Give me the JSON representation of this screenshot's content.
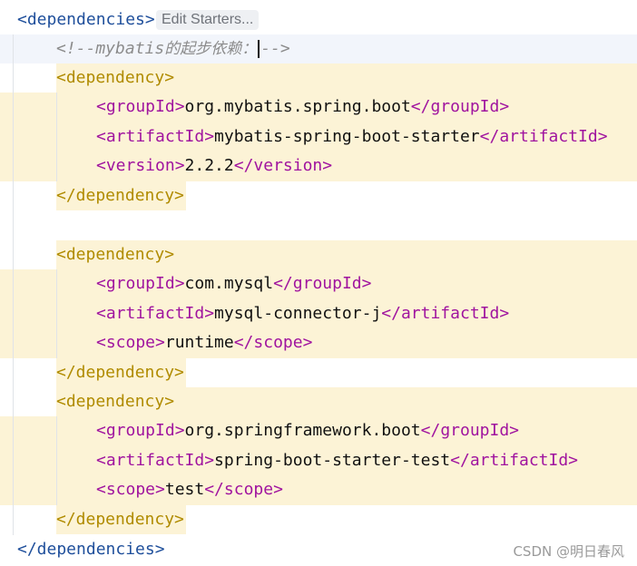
{
  "editor": {
    "inlay_hint": "Edit Starters...",
    "lines": {
      "deps_open": "<dependencies>",
      "comment_prefix": "<!--mybatis",
      "comment_cjk": "的起步依赖：",
      "comment_suffix": "-->",
      "dep1_open": "<dependency>",
      "dep1_group_open": "<groupId>",
      "dep1_group_value": "org.mybatis.spring.boot",
      "dep1_group_close": "</groupId>",
      "dep1_artifact_open": "<artifactId>",
      "dep1_artifact_value": "mybatis-spring-boot-starter",
      "dep1_artifact_close": "</artifactId>",
      "dep1_version_open": "<version>",
      "dep1_version_value": "2.2.2",
      "dep1_version_close": "</version>",
      "dep1_close": "</dependency>",
      "dep2_open": "<dependency>",
      "dep2_group_open": "<groupId>",
      "dep2_group_value": "com.mysql",
      "dep2_group_close": "</groupId>",
      "dep2_artifact_open": "<artifactId>",
      "dep2_artifact_value": "mysql-connector-j",
      "dep2_artifact_close": "</artifactId>",
      "dep2_scope_open": "<scope>",
      "dep2_scope_value": "runtime",
      "dep2_scope_close": "</scope>",
      "dep2_close": "</dependency>",
      "dep3_open": "<dependency>",
      "dep3_group_open": "<groupId>",
      "dep3_group_value": "org.springframework.boot",
      "dep3_group_close": "</groupId>",
      "dep3_artifact_open": "<artifactId>",
      "dep3_artifact_value": "spring-boot-starter-test",
      "dep3_artifact_close": "</artifactId>",
      "dep3_scope_open": "<scope>",
      "dep3_scope_value": "test",
      "dep3_scope_close": "</scope>",
      "dep3_close": "</dependency>",
      "deps_close": "</dependencies>"
    }
  },
  "watermark": "CSDN @明日春风",
  "colors": {
    "tag_dependency": "#b08b00",
    "tag_dependencies": "#1f4f9b",
    "tag_element": "#a0149f",
    "comment": "#8c8c8c",
    "highlight": "#fcf3d6"
  }
}
